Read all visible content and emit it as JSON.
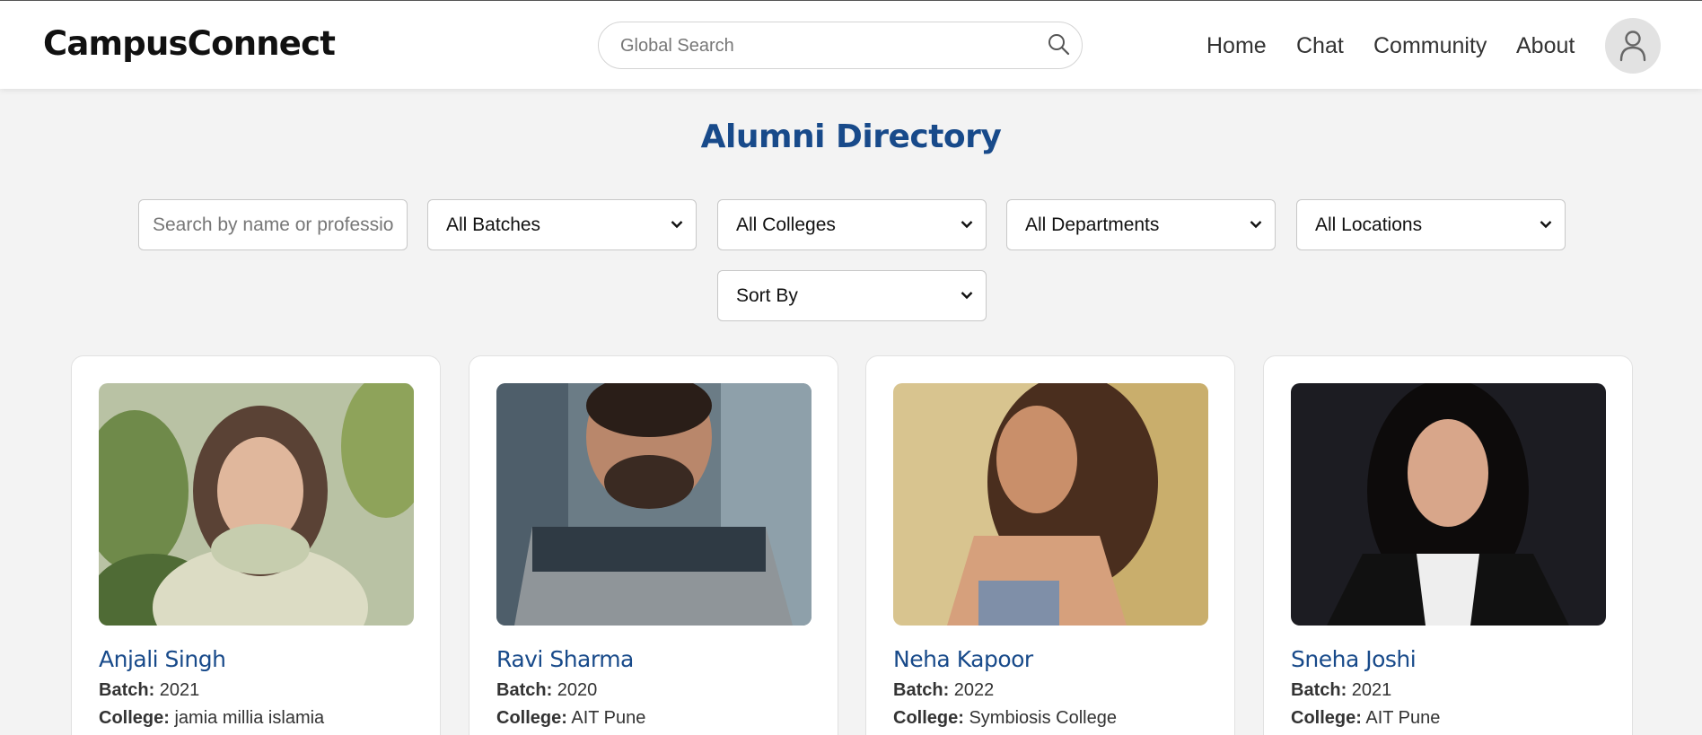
{
  "header": {
    "logo": "CampusConnect",
    "search_placeholder": "Global Search",
    "nav": [
      "Home",
      "Chat",
      "Community",
      "About"
    ]
  },
  "page": {
    "title": "Alumni Directory"
  },
  "filters": {
    "search_placeholder": "Search by name or profession",
    "batches": "All Batches",
    "colleges": "All Colleges",
    "departments": "All Departments",
    "locations": "All Locations",
    "sort": "Sort By"
  },
  "labels": {
    "batch": "Batch:",
    "college": "College:"
  },
  "alumni": [
    {
      "name": "Anjali Singh",
      "batch": "2021",
      "college": "jamia millia islamia"
    },
    {
      "name": "Ravi Sharma",
      "batch": "2020",
      "college": "AIT Pune"
    },
    {
      "name": "Neha Kapoor",
      "batch": "2022",
      "college": "Symbiosis College"
    },
    {
      "name": "Sneha Joshi",
      "batch": "2021",
      "college": "AIT Pune"
    }
  ],
  "colors": {
    "accent": "#184a8a",
    "background": "#f3f3f3"
  }
}
